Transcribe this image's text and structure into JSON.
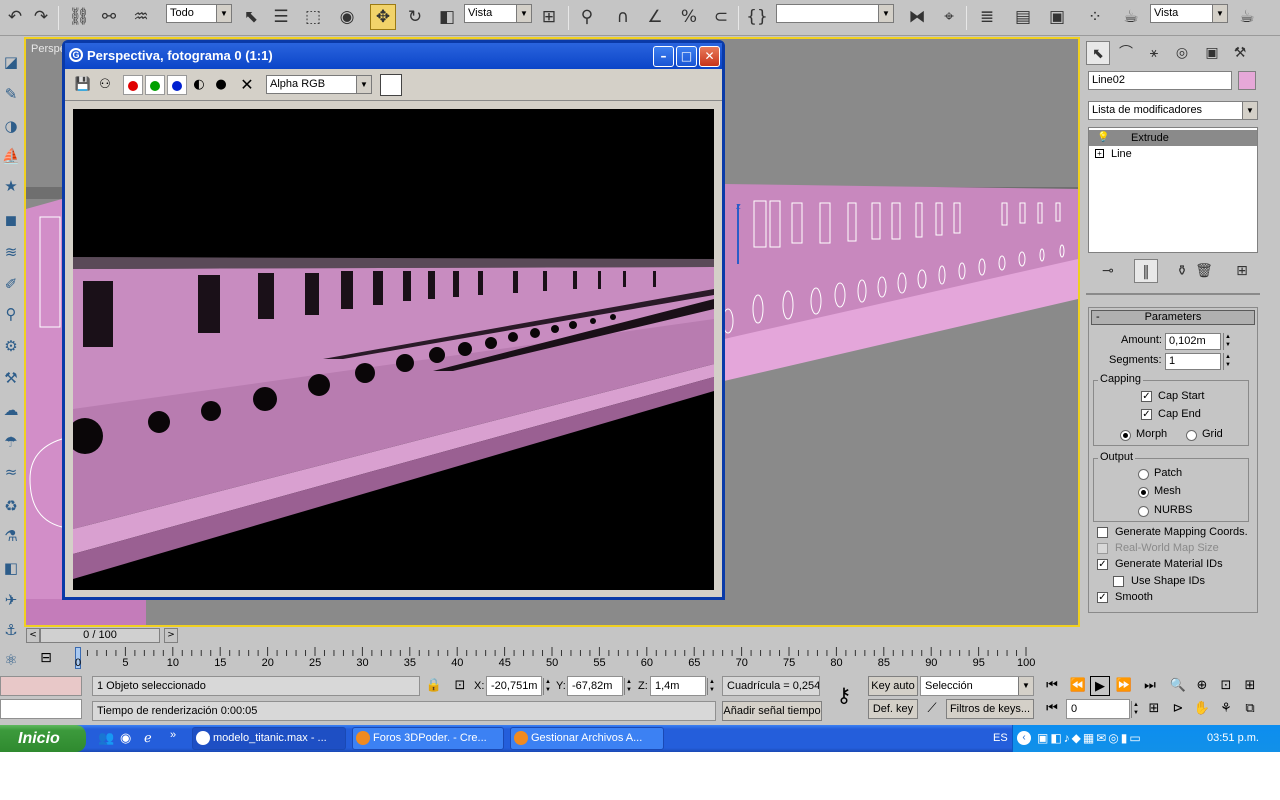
{
  "toolbar": {
    "selection_filter": "Todo",
    "coordinate_system": "Vista",
    "named_selection": "",
    "view_right": "Vista"
  },
  "viewport": {
    "label": "Perspectiva"
  },
  "render_window": {
    "title": "Perspectiva, fotograma 0 (1:1)",
    "channel_select": "Alpha RGB",
    "minimize": "–",
    "maximize": "□",
    "close": "✕"
  },
  "command_panel": {
    "object_name": "Line02",
    "object_color": "#e6a8d8",
    "modifier_list": "Lista de modificadores",
    "stack": [
      "Extrude",
      "Line"
    ],
    "parameters": {
      "title": "Parameters",
      "amount_label": "Amount:",
      "amount_value": "0,102m",
      "segments_label": "Segments:",
      "segments_value": "1",
      "capping_title": "Capping",
      "cap_start": "Cap Start",
      "cap_end": "Cap End",
      "morph": "Morph",
      "grid": "Grid",
      "output_title": "Output",
      "patch": "Patch",
      "mesh": "Mesh",
      "nurbs": "NURBS",
      "gen_mapping": "Generate Mapping Coords.",
      "real_world": "Real-World Map Size",
      "gen_material": "Generate Material IDs",
      "use_shape_ids": "Use Shape IDs",
      "smooth": "Smooth"
    }
  },
  "timeline": {
    "position": "0 / 100",
    "ticks": [
      "0",
      "5",
      "10",
      "15",
      "20",
      "25",
      "30",
      "35",
      "40",
      "45",
      "50",
      "55",
      "60",
      "65",
      "70",
      "75",
      "80",
      "85",
      "90",
      "95",
      "100"
    ]
  },
  "status": {
    "selection": "1 Objeto seleccionado",
    "render_time": "Tiempo de renderización  0:00:05",
    "x_label": "X:",
    "x_value": "-20,751m",
    "y_label": "Y:",
    "y_value": "-67,82m",
    "z_label": "Z:",
    "z_value": "1,4m",
    "grid": "Cuadrícula = 0,254m",
    "add_time_tag": "Añadir señal tiempo",
    "key_auto": "Key auto",
    "def_key": "Def. key",
    "key_mode": "Selección",
    "key_filters": "Filtros de keys...",
    "frame": "0"
  },
  "taskbar": {
    "start": "Inicio",
    "items": [
      "modelo_titanic.max - ...",
      "Foros 3DPoder. - Cre...",
      "Gestionar Archivos A..."
    ],
    "lang": "ES",
    "clock": "03:51 p.m."
  },
  "colors": {
    "hull": "#d28ec8",
    "active_border": "#f0d020",
    "title_blue": "#0b45c8"
  }
}
